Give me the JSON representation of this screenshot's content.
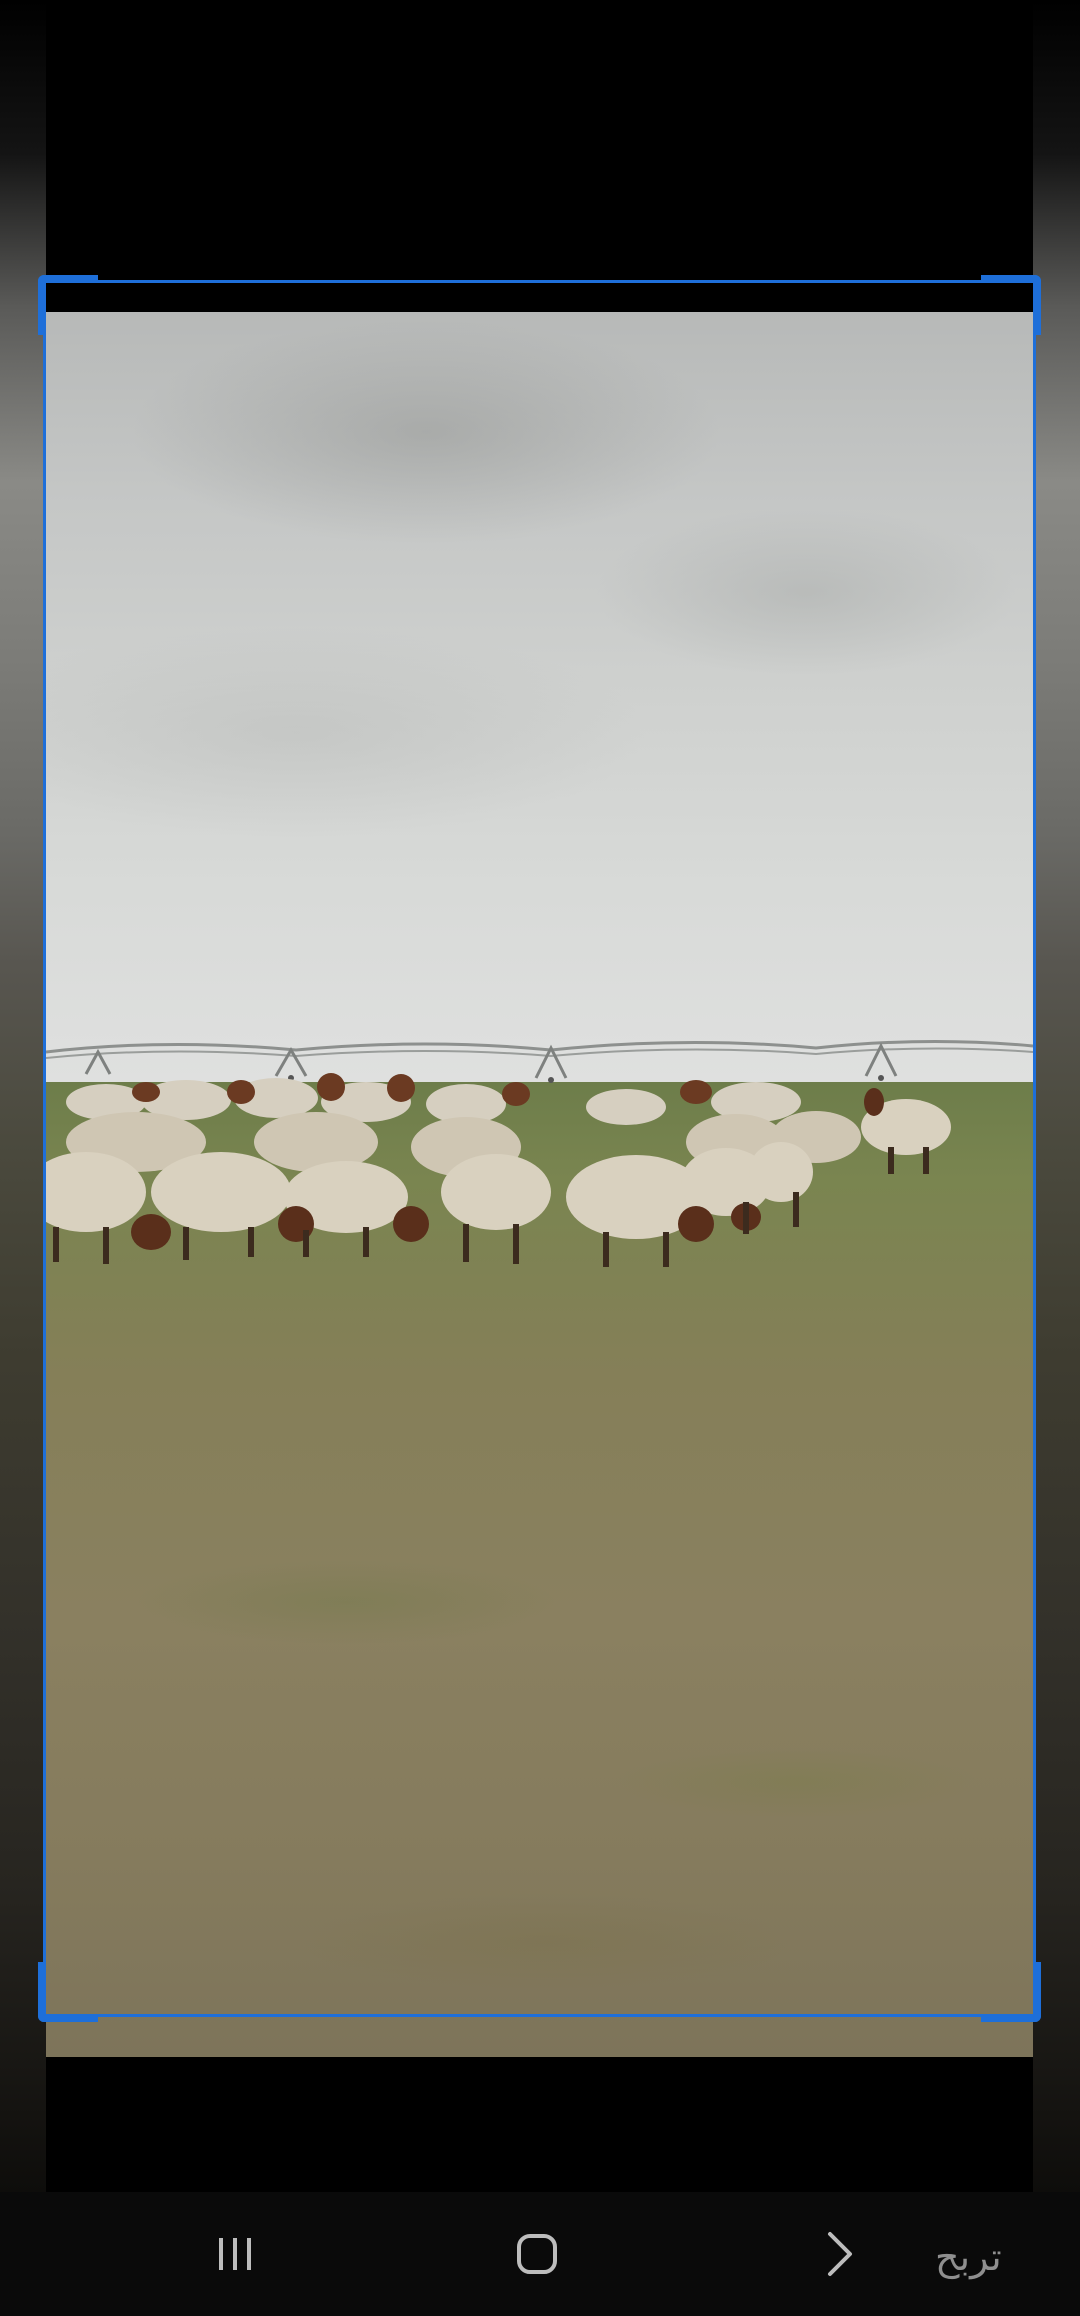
{
  "screen": {
    "photo_description_icon": "sheep-flock-photo",
    "crop_color": "#1e6fd9"
  },
  "navbar": {
    "recents_icon": "recents-icon",
    "home_icon": "home-icon",
    "back_icon": "chevron-right-icon"
  },
  "watermark": {
    "text": "تربح"
  }
}
